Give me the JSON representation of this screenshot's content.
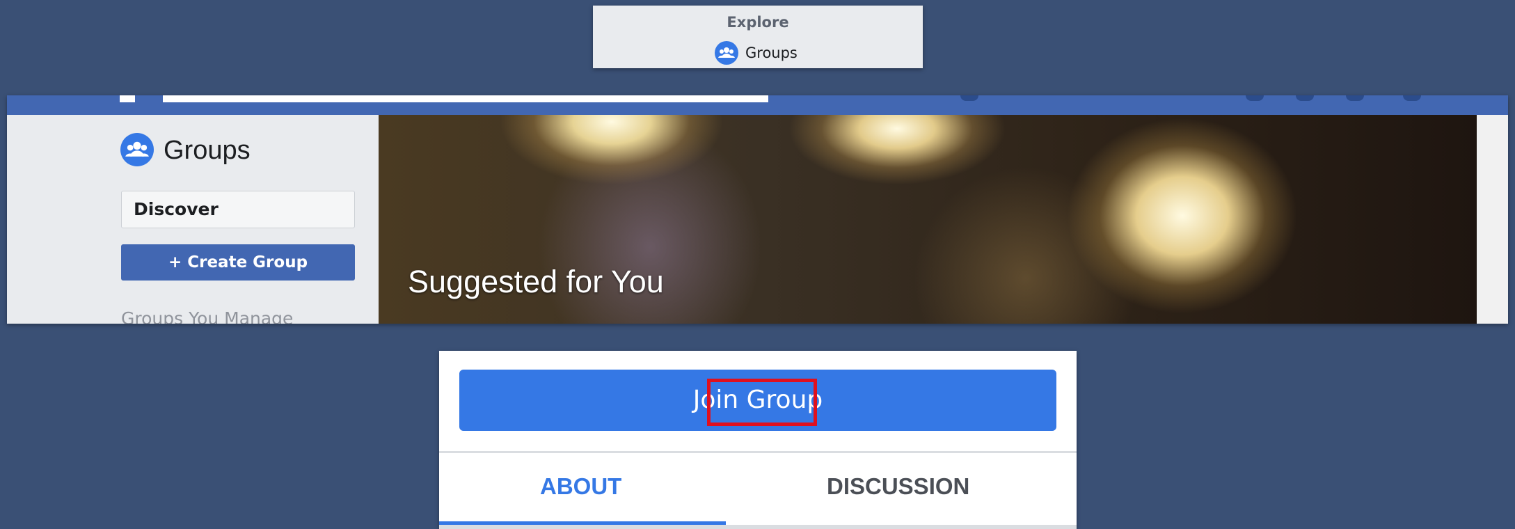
{
  "explore_panel": {
    "heading": "Explore",
    "item": {
      "label": "Groups",
      "icon": "groups-icon"
    }
  },
  "groups_page": {
    "rail": {
      "title": "Groups",
      "title_icon": "groups-icon",
      "discover_label": "Discover",
      "create_group_label": "+ Create Group",
      "section_label": "Groups You Manage"
    },
    "hero": {
      "title": "Suggested for You"
    }
  },
  "join_panel": {
    "join_button_label": "Join Group",
    "tabs": [
      {
        "label": "ABOUT",
        "active": true
      },
      {
        "label": "DISCUSSION",
        "active": false
      }
    ]
  },
  "colors": {
    "background": "#3a5075",
    "facebook_blue": "#4267b2",
    "button_blue": "#3578e5",
    "highlight_red": "#e0101e"
  }
}
